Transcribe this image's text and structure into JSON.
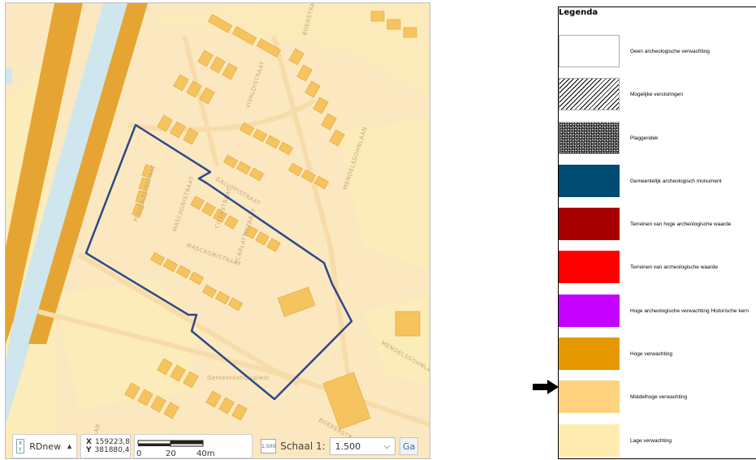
{
  "map": {
    "street_labels": [
      "BOERSTRAAT",
      "VIVALDISTRAAT",
      "MENDELSSOHNLAAN",
      "GALUPPISTRAAT",
      "PERGOLESISTRAAT",
      "MASCAGNISTRAAT",
      "CILEASTRAAT",
      "MASCAGNISTRAAT",
      "SCARLATTISTRAAT",
      "MENDELSSOHNLAAN",
      "Gemeentehuisplein",
      "BOEKERSTRAAT",
      "AAN"
    ],
    "colors": {
      "base": "#fbe8c0",
      "blocks": "#f5c45e",
      "blocks_outline": "#e8ad48",
      "canal": "#cfe6ee",
      "high_zone": "#e6a532",
      "low_zone": "#fcefb4",
      "boundary": "#2e4a86"
    }
  },
  "toolbar": {
    "crs_icon_top": "X",
    "crs_icon_bottom": "Y",
    "crs_label": "RDnew",
    "crs_caret": "▲",
    "x_label": "X",
    "x_value": "159223,82",
    "y_label": "Y",
    "y_value": "381880,48",
    "scalebar_ticks": [
      "0",
      "20",
      "40m"
    ],
    "scale_icon_text": "1:500",
    "scale_label": "Schaal 1:",
    "scale_value": "1.500",
    "go_label": "Ga"
  },
  "legend": {
    "title": "Legenda",
    "items": [
      {
        "label": "Geen archeologische verwachting",
        "color": "#ffffff",
        "pattern": "none"
      },
      {
        "label": "Mogelijke verstoringen",
        "color": "#ffffff",
        "pattern": "hatch"
      },
      {
        "label": "Plaggendek",
        "color": "#ffffff",
        "pattern": "noise"
      },
      {
        "label": "Gemeentelijk archeologisch monument",
        "color": "#004b72",
        "pattern": "none"
      },
      {
        "label": "Terreinen van hoge archeologische waarde",
        "color": "#a80000",
        "pattern": "none"
      },
      {
        "label": "Terreinen van archeologische waarde",
        "color": "#ff0000",
        "pattern": "none"
      },
      {
        "label": "Hoge archeologische verwachting Historische kern",
        "color": "#c500ff",
        "pattern": "none"
      },
      {
        "label": "Hoge verwachting",
        "color": "#e69800",
        "pattern": "none"
      },
      {
        "label": "Middelhoge verwachting",
        "color": "#ffd37f",
        "pattern": "none"
      },
      {
        "label": "Lage verwachting",
        "color": "#ffebaf",
        "pattern": "none"
      }
    ],
    "indicator_icon": "arrow-right-icon"
  }
}
